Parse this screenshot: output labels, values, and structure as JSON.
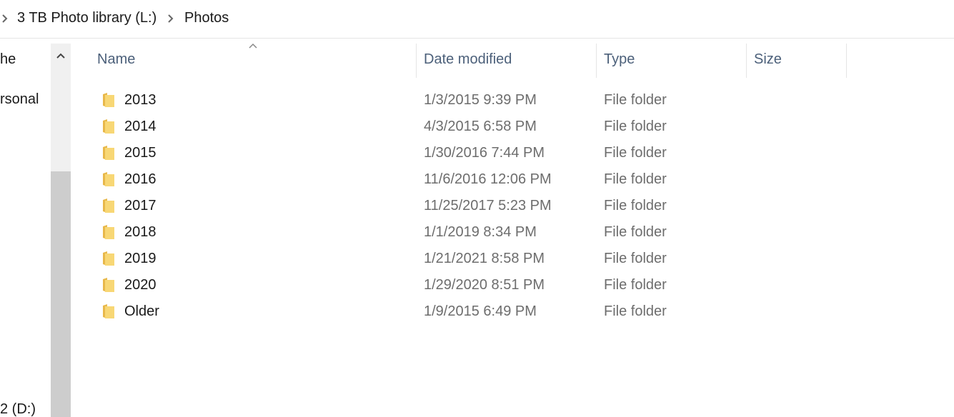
{
  "breadcrumb": {
    "items": [
      {
        "label": "3 TB Photo library (L:)"
      },
      {
        "label": "Photos"
      }
    ]
  },
  "nav": {
    "items": [
      {
        "label": "he"
      },
      {
        "label": "rsonal"
      },
      {
        "label": "2 (D:)"
      }
    ]
  },
  "columns": {
    "name": "Name",
    "date": "Date modified",
    "type": "Type",
    "size": "Size"
  },
  "files": [
    {
      "name": "2013",
      "date": "1/3/2015 9:39 PM",
      "type": "File folder"
    },
    {
      "name": "2014",
      "date": "4/3/2015 6:58 PM",
      "type": "File folder"
    },
    {
      "name": "2015",
      "date": "1/30/2016 7:44 PM",
      "type": "File folder"
    },
    {
      "name": "2016",
      "date": "11/6/2016 12:06 PM",
      "type": "File folder"
    },
    {
      "name": "2017",
      "date": "11/25/2017 5:23 PM",
      "type": "File folder"
    },
    {
      "name": "2018",
      "date": "1/1/2019 8:34 PM",
      "type": "File folder"
    },
    {
      "name": "2019",
      "date": "1/21/2021 8:58 PM",
      "type": "File folder"
    },
    {
      "name": "2020",
      "date": "1/29/2020 8:51 PM",
      "type": "File folder"
    },
    {
      "name": "Older",
      "date": "1/9/2015 6:49 PM",
      "type": "File folder"
    }
  ],
  "colors": {
    "folder": "#f8d775",
    "folder_dark": "#e8b84a",
    "header_text": "#4c607a",
    "secondary_text": "#6d6d6d"
  }
}
